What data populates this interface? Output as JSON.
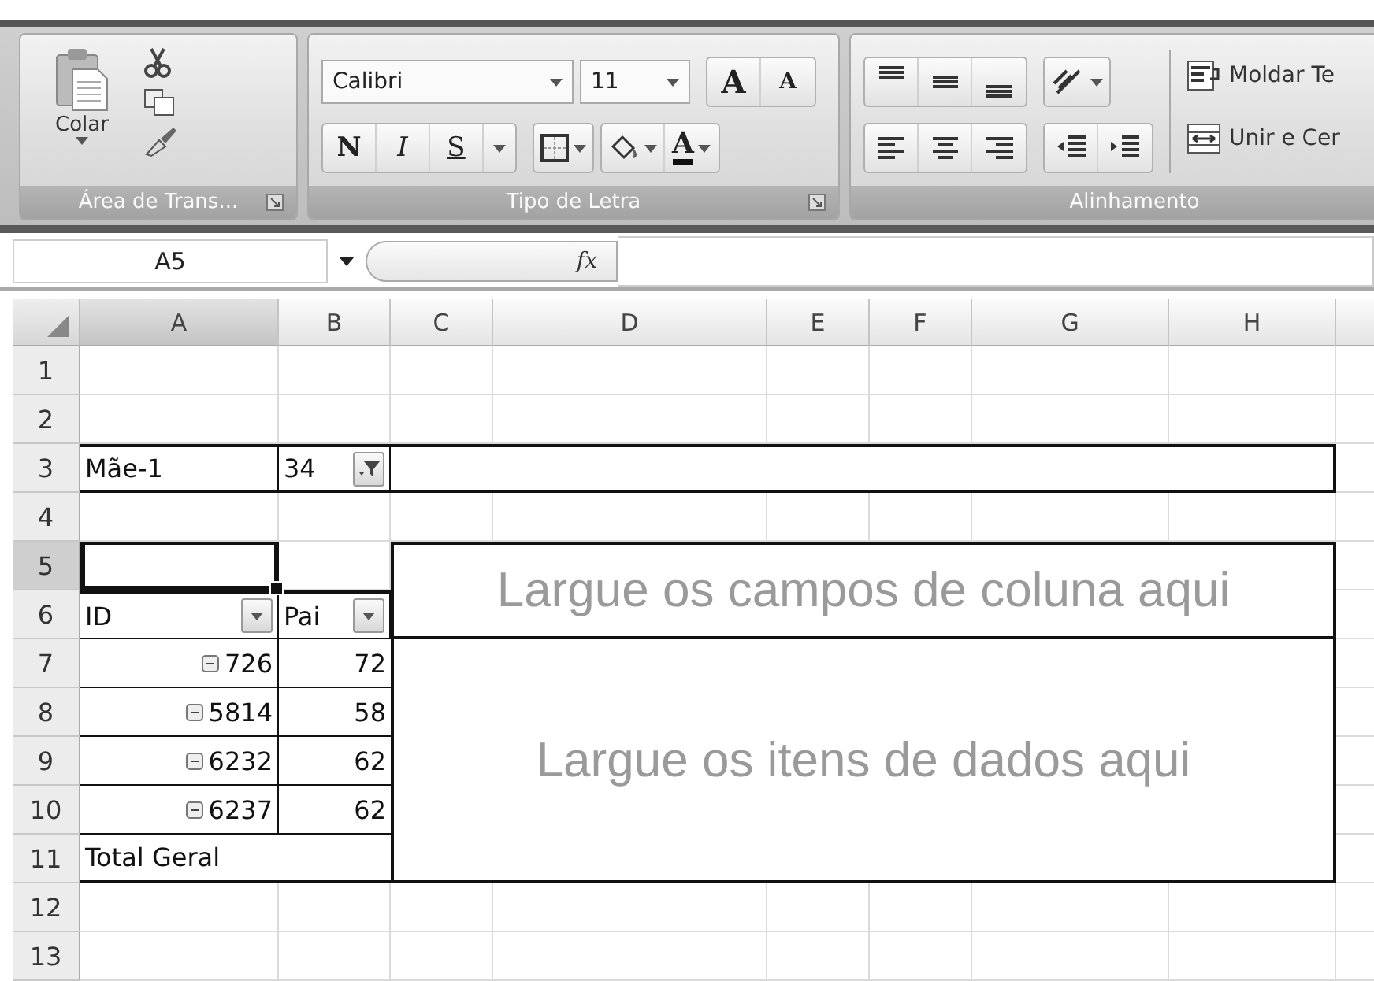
{
  "ribbon": {
    "groups": [
      {
        "kind": "clipboard",
        "label": "Área de Trans...",
        "paste_label": "Colar"
      },
      {
        "kind": "font",
        "label": "Tipo de Letra",
        "font_name": "Calibri",
        "font_size": "11",
        "grow_label": "A",
        "shrink_label": "A",
        "style_buttons": [
          "N",
          "I",
          "S"
        ],
        "color_label": "A"
      },
      {
        "kind": "alignment",
        "label": "Alinhamento",
        "wrap_label": "Moldar Te",
        "merge_label": "Unir e Cer"
      }
    ]
  },
  "formula_bar": {
    "name_box": "A5",
    "function_label": "fx"
  },
  "sheet": {
    "columns": [
      {
        "label": "A",
        "selected": true
      },
      {
        "label": "B",
        "selected": false
      },
      {
        "label": "C",
        "selected": false
      },
      {
        "label": "D",
        "selected": false
      },
      {
        "label": "E",
        "selected": false
      },
      {
        "label": "F",
        "selected": false
      },
      {
        "label": "G",
        "selected": false
      },
      {
        "label": "H",
        "selected": false
      }
    ],
    "rows": [
      {
        "label": "1",
        "selected": false
      },
      {
        "label": "2",
        "selected": false
      },
      {
        "label": "3",
        "selected": false
      },
      {
        "label": "4",
        "selected": false
      },
      {
        "label": "5",
        "selected": true
      },
      {
        "label": "6",
        "selected": false
      },
      {
        "label": "7",
        "selected": false
      },
      {
        "label": "8",
        "selected": false
      },
      {
        "label": "9",
        "selected": false
      },
      {
        "label": "10",
        "selected": false
      },
      {
        "label": "11",
        "selected": false
      },
      {
        "label": "12",
        "selected": false
      },
      {
        "label": "13",
        "selected": false
      }
    ]
  },
  "pivot": {
    "page_field": {
      "label": "Mãe-1",
      "value": "34",
      "filtered": true
    },
    "row_fields": [
      {
        "label": "ID"
      },
      {
        "label": "Pai"
      }
    ],
    "items": [
      {
        "id": "726",
        "pai": "72",
        "expanded": true
      },
      {
        "id": "5814",
        "pai": "58",
        "expanded": true
      },
      {
        "id": "6232",
        "pai": "62",
        "expanded": true
      },
      {
        "id": "6237",
        "pai": "62",
        "expanded": true
      }
    ],
    "total_label": "Total Geral",
    "column_drop": "Largue os campos de coluna aqui",
    "data_drop": "Largue os itens de dados aqui"
  }
}
